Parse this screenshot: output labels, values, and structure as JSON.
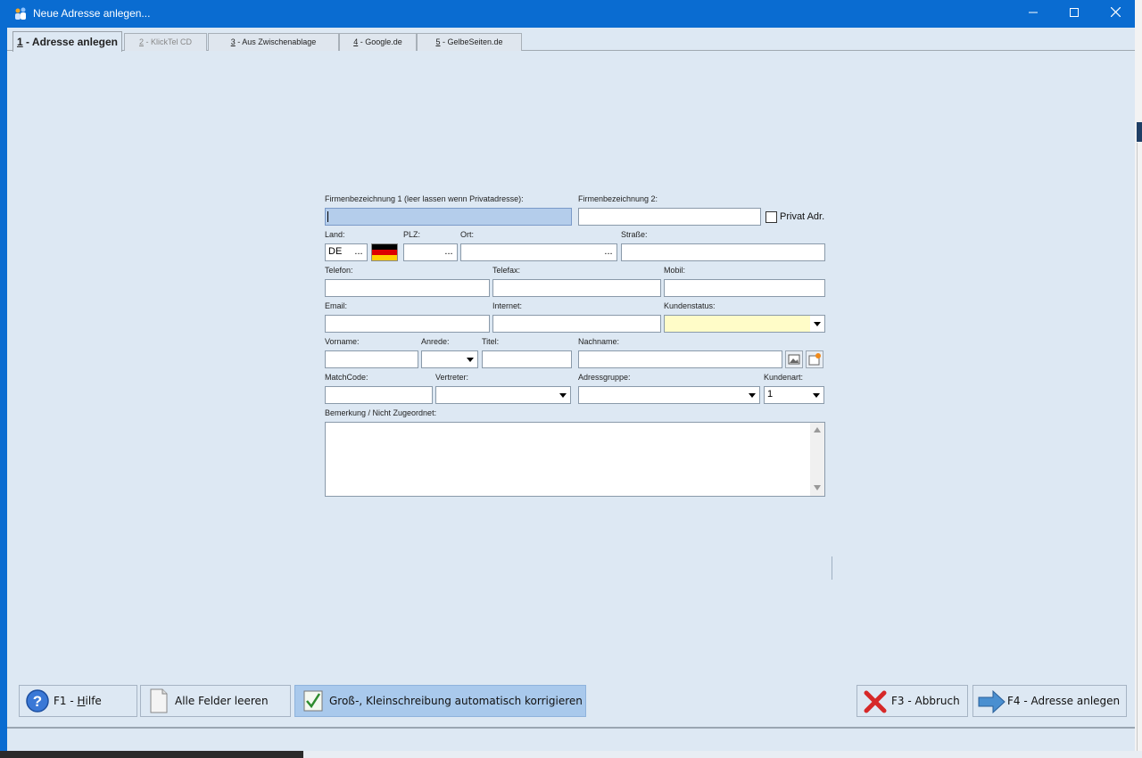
{
  "window": {
    "title": "Neue Adresse anlegen..."
  },
  "tabs": [
    {
      "key": "1",
      "label": " - Adresse anlegen",
      "state": "active"
    },
    {
      "key": "2",
      "label": " - KlickTel CD",
      "state": "disabled"
    },
    {
      "key": "3",
      "label": " - Aus Zwischenablage",
      "state": "normal"
    },
    {
      "key": "4",
      "label": " - Google.de",
      "state": "normal"
    },
    {
      "key": "5",
      "label": " - GelbeSeiten.de",
      "state": "normal"
    }
  ],
  "form": {
    "firma1_label": "Firmenbezeichnung 1 (leer lassen wenn Privatadresse):",
    "firma2_label": "Firmenbezeichnung 2:",
    "privat_label": "Privat Adr.",
    "land_label": "Land:",
    "land_value": "DE",
    "plz_label": "PLZ:",
    "ort_label": "Ort:",
    "strasse_label": "Straße:",
    "telefon_label": "Telefon:",
    "telefax_label": "Telefax:",
    "mobil_label": "Mobil:",
    "email_label": "Email:",
    "internet_label": "Internet:",
    "kundenstatus_label": "Kundenstatus:",
    "vorname_label": "Vorname:",
    "anrede_label": "Anrede:",
    "titel_label": "Titel:",
    "nachname_label": "Nachname:",
    "matchcode_label": "MatchCode:",
    "vertreter_label": "Vertreter:",
    "adressgruppe_label": "Adressgruppe:",
    "kundenart_label": "Kundenart:",
    "kundenart_value": "1",
    "bemerkung_label": "Bemerkung / Nicht Zugeordnet:",
    "dots": "..."
  },
  "buttons": {
    "help_prefix": "F1 - ",
    "help_key": "H",
    "help_rest": "ilfe",
    "clear": "Alle Felder leeren",
    "autocase": "Groß-, Kleinschreibung automatisch korrigieren",
    "cancel": "F3 - Abbruch",
    "create": "F4 - Adresse anlegen"
  },
  "icons": {
    "app": "address-app-icon",
    "help": "help-question-icon",
    "clear": "blank-page-icon",
    "autocase": "checkmark-icon",
    "cancel": "red-x-icon",
    "create": "blue-arrow-right-icon",
    "flag": "germany-flag-icon"
  },
  "colors": {
    "titlebar": "#0a6cd1",
    "client": "#dde8f3",
    "focus": "#b4cdeb",
    "kundenstatus": "#fffcc8"
  }
}
